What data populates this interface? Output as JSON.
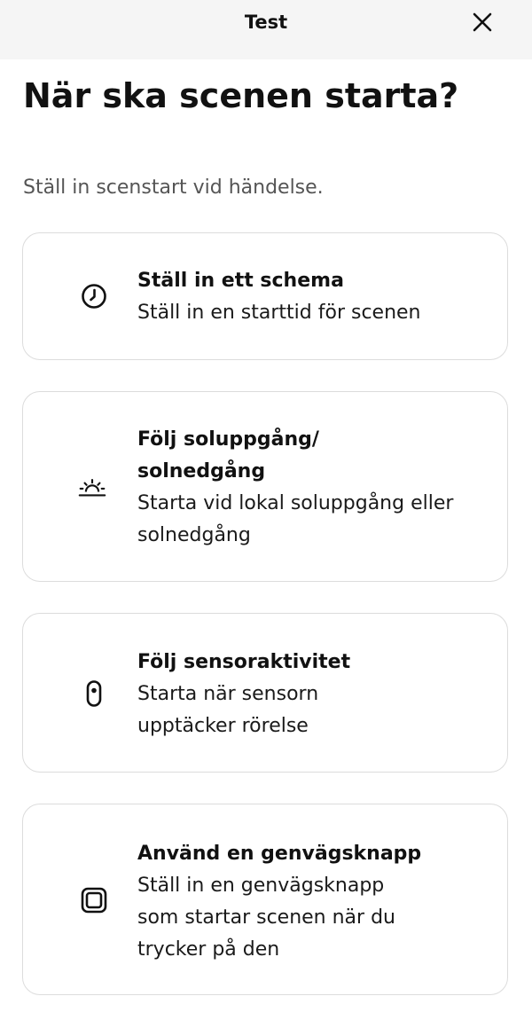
{
  "topbar": {
    "title": "Test"
  },
  "page": {
    "title": "När ska scenen starta?",
    "subtitle": "Ställ in scenstart vid händelse."
  },
  "options": [
    {
      "icon": "clock-icon",
      "title": "Ställ in ett schema",
      "description": "Ställ in en starttid för scenen"
    },
    {
      "icon": "sunrise-icon",
      "title": "Följ soluppgång/ solnedgång",
      "description": "Starta vid lokal soluppgång eller solnedgång"
    },
    {
      "icon": "motion-sensor-icon",
      "title": "Följ sensoraktivitet",
      "description": "Starta när sensorn upptäcker rörelse"
    },
    {
      "icon": "shortcut-button-icon",
      "title": "Använd en genvägsknapp",
      "description": "Ställ in en genvägsknapp som startar scenen när du trycker på den"
    }
  ]
}
